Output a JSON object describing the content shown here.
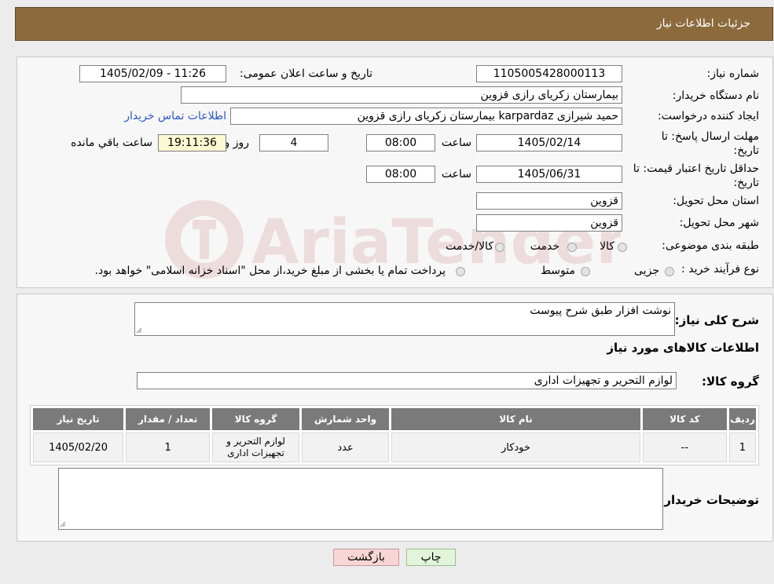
{
  "header": {
    "title": "جزئیات اطلاعات نیاز"
  },
  "form": {
    "need_number_label": "شماره نیاز:",
    "need_number": "1105005428000113",
    "announce_label": "تاریخ و ساعت اعلان عمومی:",
    "announce_value": "1405/02/09 - 11:26",
    "buyer_org_label": "نام دستگاه خریدار:",
    "buyer_org": "بیمارستان زکریای رازی قزوین",
    "requester_label": "ایجاد کننده درخواست:",
    "requester": "حمید شیرازی karpardaz بیمارستان زکریای رازی قزوین",
    "contact_link": "اطلاعات تماس خریدار",
    "deadline_label": "مهلت ارسال پاسخ: تا تاریخ:",
    "deadline_date": "1405/02/14",
    "time_label": "ساعت",
    "deadline_time": "08:00",
    "days": "4",
    "days_label": "روز و",
    "remaining": "19:11:36",
    "remaining_label": "ساعت باقي مانده",
    "validity_label": "حداقل تاریخ اعتبار قیمت: تا تاریخ:",
    "validity_date": "1405/06/31",
    "validity_time": "08:00",
    "province_label": "استان محل تحویل:",
    "province": "قزوین",
    "city_label": "شهر محل تحویل:",
    "city": "قزوین",
    "category_label": "طبقه بندی موضوعی:",
    "category_options": [
      "کالا",
      "خدمت",
      "کالا/خدمت"
    ],
    "process_label": "نوع فرآیند خرید :",
    "process_options": [
      "جزیی",
      "متوسط"
    ],
    "process_note": "پرداخت تمام یا بخشی از مبلغ خرید،از محل \"اسناد خزانه اسلامی\" خواهد بود."
  },
  "details": {
    "desc_label": "شرح کلی نیاز:",
    "desc_value": "نوشت افزار طبق شرح پیوست",
    "items_title": "اطلاعات کالاهای مورد نیاز",
    "group_label": "گروه کالا:",
    "group_value": "لوازم التحریر و تجهیزات اداری"
  },
  "table": {
    "headers": [
      "ردیف",
      "کد کالا",
      "نام کالا",
      "واحد شمارش",
      "گروه کالا",
      "تعداد / مقدار",
      "تاریخ نیاز"
    ],
    "rows": [
      [
        "1",
        "--",
        "خودکار",
        "عدد",
        "لوازم التحریر و تجهیزات اداری",
        "1",
        "1405/02/20"
      ]
    ]
  },
  "buyer_notes_label": "توضیحات خریدار:",
  "buttons": {
    "print": "چاپ",
    "back": "بازگشت"
  },
  "watermark_text": "AriaTender.neT",
  "colors": {
    "header_bg": "#8c6a3c",
    "link": "#2a56c6",
    "back_bg": "#f9d6d6",
    "print_bg": "#e2f5da"
  }
}
